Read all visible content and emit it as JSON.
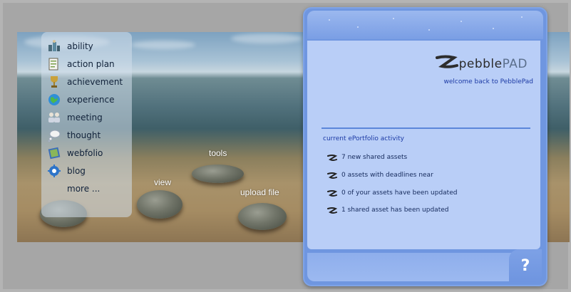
{
  "menu": {
    "items": [
      {
        "label": "ability",
        "icon": "group-icon"
      },
      {
        "label": "action plan",
        "icon": "clipboard-icon"
      },
      {
        "label": "achievement",
        "icon": "trophy-icon"
      },
      {
        "label": "experience",
        "icon": "globe-icon"
      },
      {
        "label": "meeting",
        "icon": "people-icon"
      },
      {
        "label": "thought",
        "icon": "thought-bubble-icon"
      },
      {
        "label": "webfolio",
        "icon": "book-icon"
      },
      {
        "label": "blog",
        "icon": "gear-icon"
      },
      {
        "label": "more ..."
      }
    ]
  },
  "scene": {
    "labels": {
      "tools": "tools",
      "view": "view",
      "upload": "upload file"
    }
  },
  "panel": {
    "logo": {
      "main": "pebble",
      "accent": "PAD"
    },
    "welcome": "welcome back to PebblePad",
    "activity_title": "current ePortfolio activity",
    "activity": [
      "7 new shared assets",
      "0 assets with deadlines near",
      "0 of your assets have been updated",
      "1 shared asset has been updated"
    ],
    "help_label": "?"
  },
  "colors": {
    "panel": "#6f96e0",
    "panel_body": "#b9cef7",
    "link": "#1c3aa5"
  }
}
